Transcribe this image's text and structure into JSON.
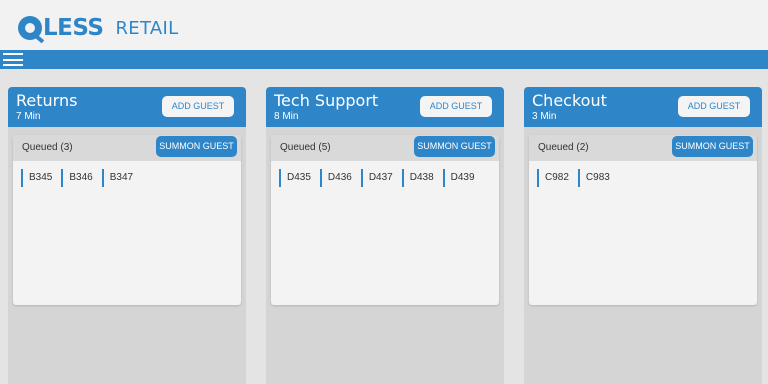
{
  "app": {
    "logo_word": "LESS",
    "logo_sub": "RETAIL",
    "accent_color": "#2e86c9"
  },
  "nav": {
    "menu_icon": "hamburger-menu-icon"
  },
  "queues": [
    {
      "title": "Returns",
      "wait": "7 Min",
      "add_label": "ADD GUEST",
      "queued_label": "Queued (3)",
      "summon_label": "SUMMON GUEST",
      "tickets": [
        "B345",
        "B346",
        "B347"
      ]
    },
    {
      "title": "Tech Support",
      "wait": "8 Min",
      "add_label": "ADD GUEST",
      "queued_label": "Queued (5)",
      "summon_label": "SUMMON GUEST",
      "tickets": [
        "D435",
        "D436",
        "D437",
        "D438",
        "D439"
      ]
    },
    {
      "title": "Checkout",
      "wait": "3 Min",
      "add_label": "ADD GUEST",
      "queued_label": "Queued (2)",
      "summon_label": "SUMMON GUEST",
      "tickets": [
        "C982",
        "C983"
      ]
    }
  ]
}
